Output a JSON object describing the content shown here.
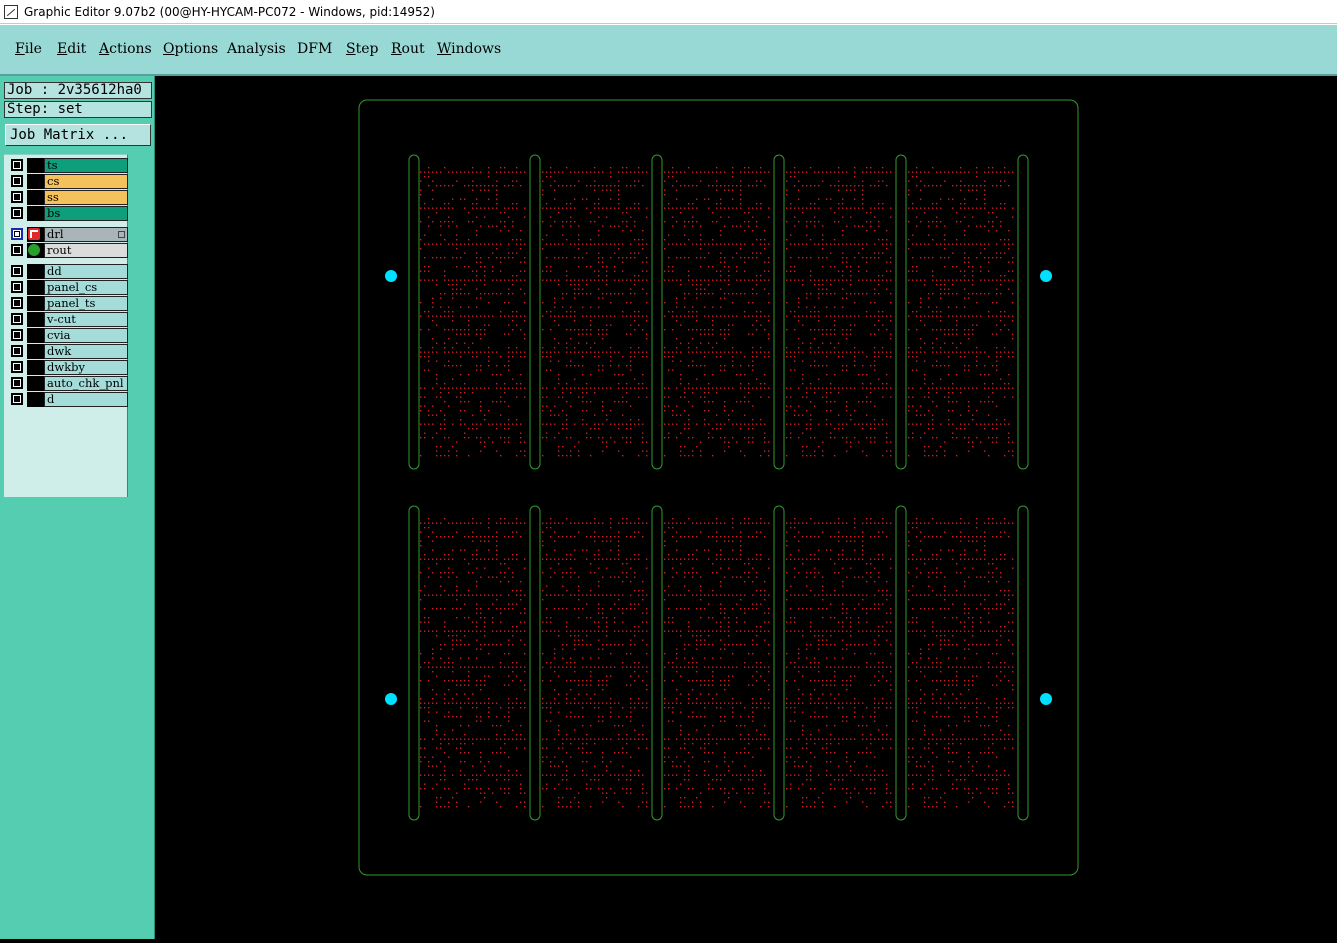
{
  "window": {
    "title": "Graphic Editor 9.07b2 (00@HY-HYCAM-PC072 - Windows, pid:14952)"
  },
  "menu": [
    {
      "first": "F",
      "rest": "ile"
    },
    {
      "first": "E",
      "rest": "dit"
    },
    {
      "first": "A",
      "rest": "ctions"
    },
    {
      "first": "O",
      "rest": "ptions"
    },
    {
      "first": "",
      "rest": "Analysis"
    },
    {
      "first": "",
      "rest": "DFM"
    },
    {
      "first": "S",
      "rest": "tep"
    },
    {
      "first": "R",
      "rest": "out"
    },
    {
      "first": "W",
      "rest": "indows"
    }
  ],
  "panel": {
    "job": "Job : 2v35612ha0",
    "step": "Step: set",
    "job_matrix": "Job Matrix ..."
  },
  "layers": {
    "board": [
      {
        "name": "ts",
        "color": "#0e9e7c"
      },
      {
        "name": "cs",
        "color": "#f5c15a"
      },
      {
        "name": "ss",
        "color": "#f5c15a"
      },
      {
        "name": "bs",
        "color": "#0e9e7c"
      }
    ],
    "drill": [
      {
        "name": "drl",
        "color": "#a9b5b8"
      },
      {
        "name": "rout",
        "color": "#dcdcdc"
      }
    ],
    "misc": [
      "dd",
      "panel_cs",
      "panel_ts",
      "v-cut",
      "cvia",
      "dwk",
      "dwkby",
      "auto_chk_pnl",
      "d"
    ],
    "misc_color": "#a4dcd9"
  },
  "colors": {
    "outline": "#2f9a2f",
    "pad": "#d42020",
    "fiducial": "#00e0ff",
    "panel_bg": "#55cdb0",
    "menu_bg": "#99d9d5"
  }
}
